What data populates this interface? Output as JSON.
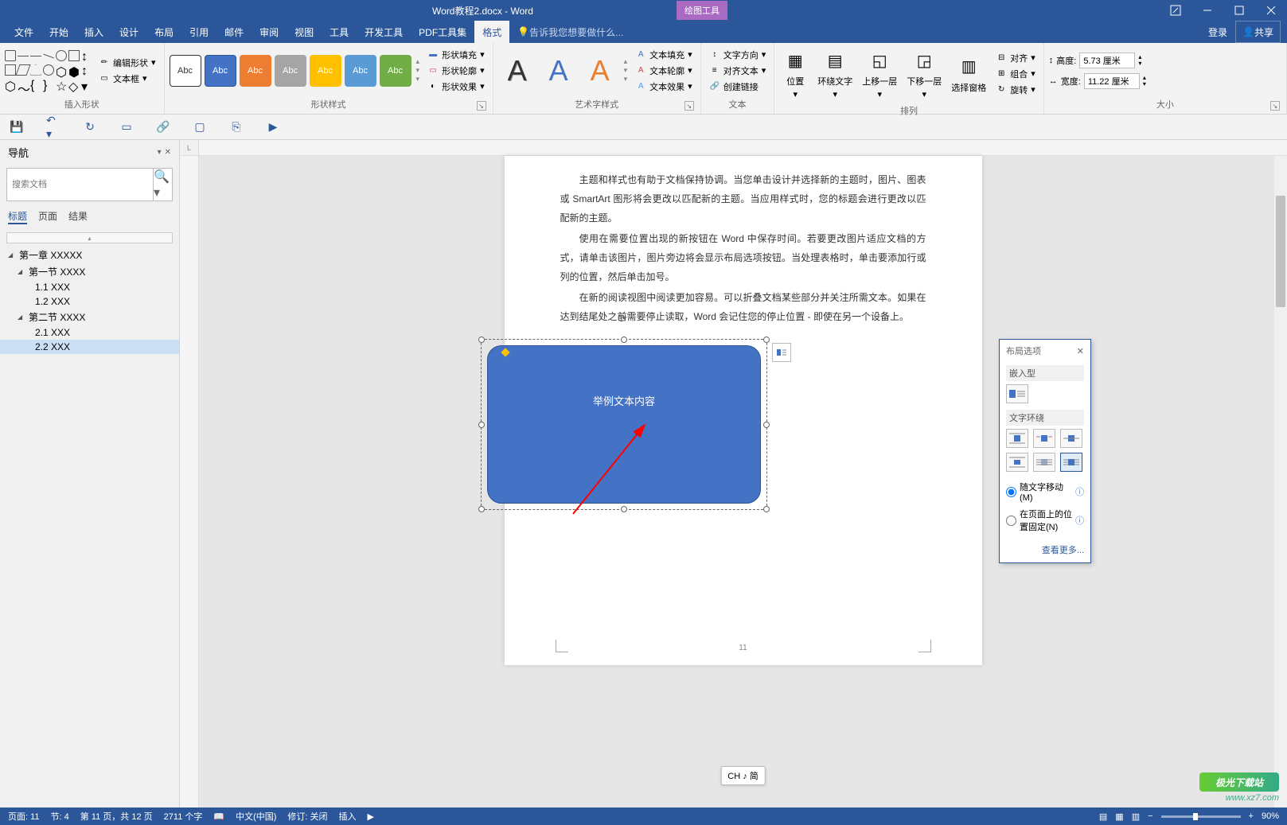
{
  "title": {
    "doc": "Word教程2.docx - Word",
    "contextTab": "绘图工具"
  },
  "menu": {
    "items": [
      "文件",
      "开始",
      "插入",
      "设计",
      "布局",
      "引用",
      "邮件",
      "审阅",
      "视图",
      "工具",
      "开发工具",
      "PDF工具集",
      "格式"
    ],
    "activeIndex": 12,
    "tellMe": "告诉我您想要做什么...",
    "login": "登录",
    "share": "共享"
  },
  "ribbon": {
    "insertShape": {
      "label": "插入形状",
      "editShape": "编辑形状",
      "textBox": "文本框"
    },
    "shapeStyles": {
      "label": "形状样式",
      "swatchText": "Abc",
      "fill": "形状填充",
      "outline": "形状轮廓",
      "effects": "形状效果"
    },
    "wordArt": {
      "label": "艺术字样式",
      "fill": "文本填充",
      "outline": "文本轮廓",
      "effects": "文本效果"
    },
    "text": {
      "label": "文本",
      "direction": "文字方向",
      "align": "对齐文本",
      "link": "创建链接"
    },
    "arrange": {
      "label": "排列",
      "position": "位置",
      "wrap": "环绕文字",
      "forward": "上移一层",
      "backward": "下移一层",
      "pane": "选择窗格",
      "alignObj": "对齐",
      "group": "组合",
      "rotate": "旋转"
    },
    "size": {
      "label": "大小",
      "heightLabel": "高度:",
      "heightValue": "5.73 厘米",
      "widthLabel": "宽度:",
      "widthValue": "11.22 厘米"
    }
  },
  "nav": {
    "title": "导航",
    "searchPlaceholder": "搜索文档",
    "tabs": [
      "标题",
      "页面",
      "结果"
    ],
    "activeTab": 0,
    "tree": [
      {
        "label": "第一章 XXXXX",
        "lvl": 0,
        "expand": true
      },
      {
        "label": "第一节 XXXX",
        "lvl": 1,
        "expand": true
      },
      {
        "label": "1.1 XXX",
        "lvl": 2
      },
      {
        "label": "1.2 XXX",
        "lvl": 2
      },
      {
        "label": "第二节 XXXX",
        "lvl": 1,
        "expand": true
      },
      {
        "label": "2.1 XXX",
        "lvl": 2
      },
      {
        "label": "2.2 XXX",
        "lvl": 2,
        "selected": true
      }
    ]
  },
  "doc": {
    "p1": "主题和样式也有助于文档保持协调。当您单击设计并选择新的主题时，图片、图表或 SmartArt 图形将会更改以匹配新的主题。当应用样式时，您的标题会进行更改以匹配新的主题。",
    "p2": "使用在需要位置出现的新按钮在 Word 中保存时间。若要更改图片适应文档的方式，请单击该图片，图片旁边将会显示布局选项按钮。当处理表格时，单击要添加行或列的位置，然后单击加号。",
    "p3": "在新的阅读视图中阅读更加容易。可以折叠文档某些部分并关注所需文本。如果在达到结尾处之前需要停止读取，Word 会记住您的停止位置 - 即使在另一个设备上。",
    "shapeText": "举例文本内容",
    "pageNumber": "11"
  },
  "layoutPopup": {
    "title": "布局选项",
    "inline": "嵌入型",
    "wrap": "文字环绕",
    "opt1": "随文字移动(M)",
    "opt2": "在页面上的位置固定(N)",
    "more": "查看更多..."
  },
  "chBtn": "CH ♪ 简",
  "status": {
    "page": "页面: 11",
    "section": "节: 4",
    "pageOf": "第 11 页，共 12 页",
    "words": "2711 个字",
    "lang": "中文(中国)",
    "track": "修订: 关闭",
    "mode": "插入",
    "zoom": "90%"
  },
  "watermark": {
    "site": "极光下载站",
    "url": "www.xz7.com"
  }
}
